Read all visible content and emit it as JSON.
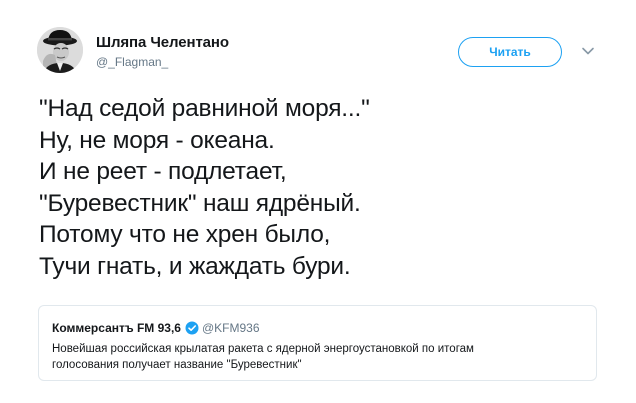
{
  "author": {
    "name": "Шляпа Челентано",
    "handle": "@_Flagman_"
  },
  "follow_button_label": "Читать",
  "icons": {
    "avatar": "avatar",
    "caret": "chevron-down-icon",
    "verified": "verified-badge-icon"
  },
  "colors": {
    "accent": "#1da1f2",
    "text": "#14171a",
    "secondary_text": "#657786",
    "border": "#e1e8ed"
  },
  "tweet": {
    "lines": [
      "\"Над седой равниной моря...\"",
      "Ну, не моря - океана.",
      "И не реет - подлетает,",
      "\"Буревестник\" наш ядрёный.",
      "Потому что не хрен было,",
      "Тучи гнать, и жаждать бури."
    ]
  },
  "quote": {
    "name": "Коммерсантъ FM 93,6",
    "handle": "@KFM936",
    "text_lines": [
      "Новейшая российская крылатая ракета с ядерной энергоустановкой по итогам",
      "голосования получает название \"Буревестник\""
    ]
  }
}
